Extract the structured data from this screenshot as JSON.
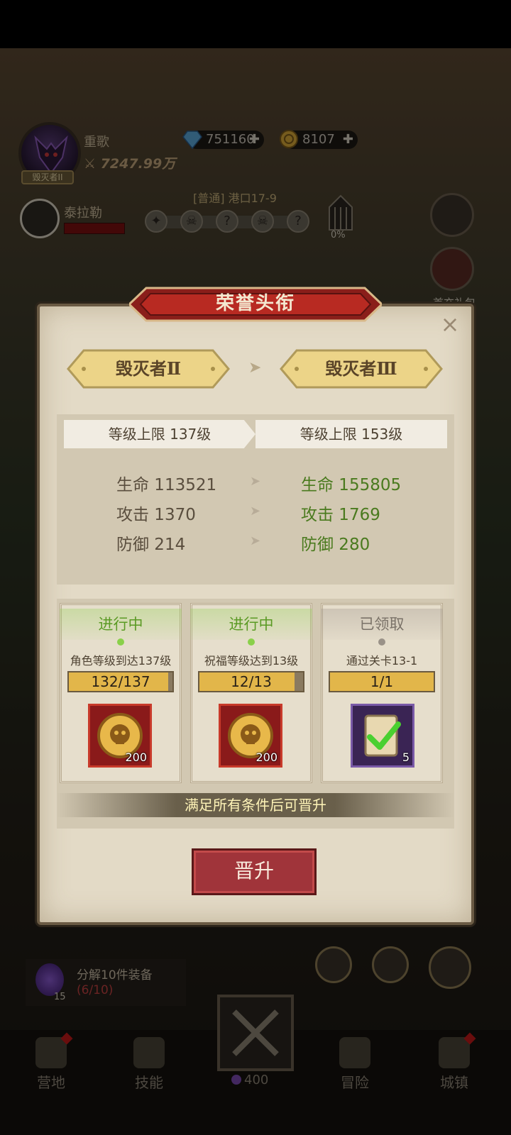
{
  "hud": {
    "player_name": "重歌",
    "power": "7247.99万",
    "rank_tag": "毁灭者II",
    "gems": "751160",
    "coins": "8107",
    "companion_name": "泰拉勒",
    "stage": "[普通] 港口17-9",
    "stage_nodes": [
      "?",
      "?"
    ],
    "boss_progress": "0%",
    "first_gift": "首充礼包"
  },
  "modal": {
    "title": "荣誉头衔",
    "close_glyph": "×",
    "current_rank": "毁灭者Ⅱ",
    "next_rank": "毁灭者Ⅲ",
    "rank_arrow": "➤",
    "level_cap_current": "等级上限 137级",
    "level_cap_next": "等级上限 153级",
    "stats": [
      {
        "old": "生命 113521",
        "new": "生命 155805"
      },
      {
        "old": "攻击 1370",
        "new": "攻击 1769"
      },
      {
        "old": "防御 214",
        "new": "防御 280"
      }
    ],
    "stat_arrow": "➤",
    "tasks": [
      {
        "status": "进行中",
        "desc": "角色等级到达137级",
        "progress_text": "132/137",
        "progress": 0.96,
        "reward_count": "200",
        "reward_icon": "skull-coin-icon"
      },
      {
        "status": "进行中",
        "desc": "祝福等级达到13级",
        "progress_text": "12/13",
        "progress": 0.92,
        "reward_count": "200",
        "reward_icon": "skull-coin-icon"
      },
      {
        "status": "已领取",
        "desc": "通过关卡13-1",
        "progress_text": "1/1",
        "progress": 1.0,
        "reward_count": "5",
        "reward_icon": "scroll-check-icon"
      }
    ],
    "hint": "满足所有条件后可晋升",
    "promote_label": "晋升"
  },
  "bottom": {
    "quest_title": "分解10件装备",
    "quest_progress": "(6/10)",
    "quest_orb_count": "15",
    "nav": [
      {
        "label": "营地",
        "icon": "tent-icon"
      },
      {
        "label": "技能",
        "icon": "skill-icon"
      },
      {
        "label": "冒险",
        "icon": "map-icon"
      },
      {
        "label": "城镇",
        "icon": "castle-icon"
      }
    ],
    "energy": "400"
  },
  "colors": {
    "active_status": "#5a9a24",
    "new_stat": "#4a7a1e",
    "promote_button": "#a0343a",
    "progress_fill": "#e2b64a"
  }
}
